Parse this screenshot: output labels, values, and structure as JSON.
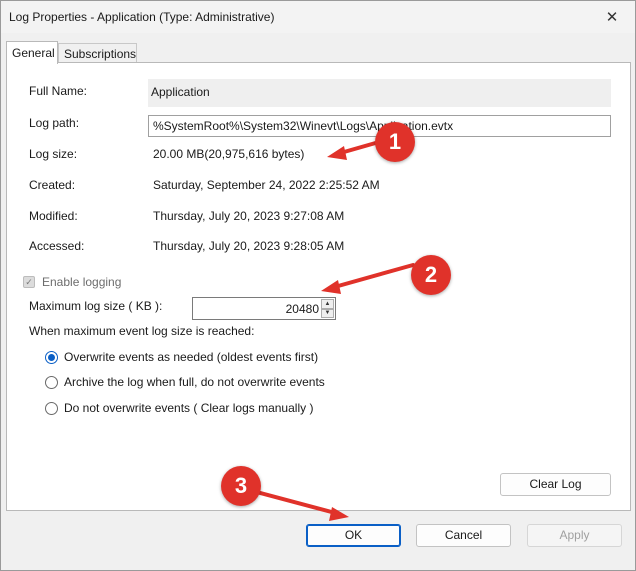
{
  "window": {
    "title": "Log Properties - Application (Type: Administrative)",
    "close_glyph": "✕"
  },
  "tabs": [
    {
      "label": "General"
    },
    {
      "label": "Subscriptions"
    }
  ],
  "general": {
    "full_name_label": "Full Name:",
    "full_name_value": "Application",
    "log_path_label": "Log path:",
    "log_path_value": "%SystemRoot%\\System32\\Winevt\\Logs\\Application.evtx",
    "log_size_label": "Log size:",
    "log_size_value": "20.00 MB(20,975,616 bytes)",
    "created_label": "Created:",
    "created_value": "Saturday, September 24, 2022 2:25:52 AM",
    "modified_label": "Modified:",
    "modified_value": "Thursday, July 20, 2023 9:27:08 AM",
    "accessed_label": "Accessed:",
    "accessed_value": "Thursday, July 20, 2023 9:28:05 AM",
    "enable_logging_label": "Enable logging",
    "enable_logging_checked": true,
    "max_size_label": "Maximum log size ( KB ):",
    "max_size_value": "20480",
    "when_max_label": "When maximum event log size is reached:",
    "options": [
      {
        "label": "Overwrite events as needed (oldest events first)",
        "selected": true
      },
      {
        "label": "Archive the log when full, do not overwrite events",
        "selected": false
      },
      {
        "label": "Do not overwrite events ( Clear logs manually )",
        "selected": false
      }
    ],
    "clear_log_label": "Clear Log"
  },
  "footer": {
    "ok_label": "OK",
    "cancel_label": "Cancel",
    "apply_label": "Apply"
  },
  "annotations": [
    {
      "label": "1"
    },
    {
      "label": "2"
    },
    {
      "label": "3"
    }
  ],
  "colors": {
    "accent": "#0a5fc6",
    "annotation": "#e0322a"
  },
  "icons": {
    "close": "close-icon",
    "checkbox": "checkmark-icon",
    "spin_up": "chevron-up-icon",
    "spin_down": "chevron-down-icon"
  }
}
